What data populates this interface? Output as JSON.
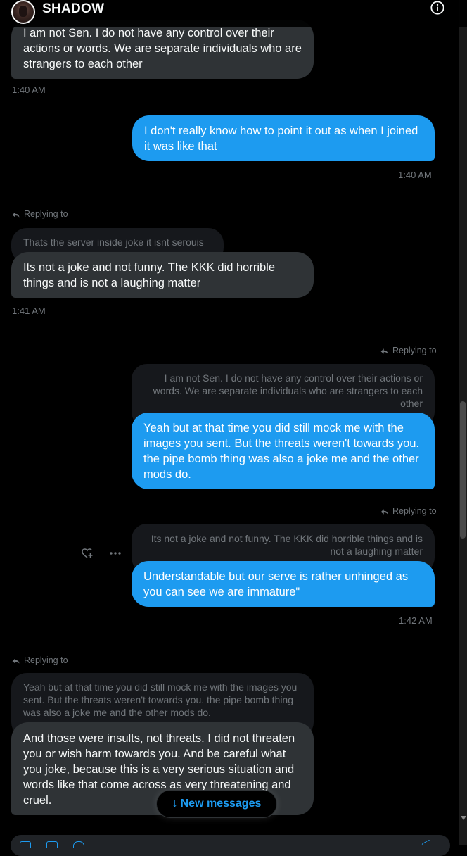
{
  "header": {
    "title": "SHADOW",
    "info_icon": "info-icon"
  },
  "messages": [
    {
      "direction": "received",
      "text": "I am not Sen. I do not have any control over their actions or words. We are separate individuals who are strangers to each other",
      "time": "1:40 AM"
    },
    {
      "direction": "sent",
      "text": "I don't really know how to point it out as when I joined it was like that",
      "time": "1:40 AM"
    },
    {
      "direction": "received",
      "replying_label": "Replying to",
      "quote": "Thats the server inside joke it isnt serouis",
      "text": "Its not a joke and not funny. The KKK did horrible things and is not a laughing matter",
      "time": "1:41 AM"
    },
    {
      "direction": "sent",
      "replying_label": "Replying to",
      "quote": "I am not Sen. I do not have any control over their actions or words. We are separate individuals who are strangers to each other",
      "text": "Yeah but at that time you did still mock me with the images you sent. But the threats weren't towards you. the pipe bomb thing was also a joke me and the other mods do."
    },
    {
      "direction": "sent",
      "replying_label": "Replying to",
      "quote": "Its not a joke and not funny. The KKK did horrible things and is not a laughing matter",
      "text": "Understandable but our serve is rather unhinged as you can see we are immature\"",
      "time": "1:42 AM"
    },
    {
      "direction": "received",
      "replying_label": "Replying to",
      "quote": "Yeah but at that time you did still mock me with the images you sent. But the threats weren't towards you. the pipe bomb thing was also a joke me and the other mods do.",
      "text": "And those were insults, not threats. I did not threaten you or wish harm towards you. And be careful what you joke, because this is a very serious situation and words like that come across as very threatening and cruel."
    }
  ],
  "new_messages": {
    "arrow": "↓",
    "label": "New messages"
  },
  "colors": {
    "sent_bubble": "#1d9bf0",
    "received_bubble": "#2f3336",
    "quote_bg": "#16181c",
    "muted_text": "#71767b",
    "background": "#000000"
  }
}
